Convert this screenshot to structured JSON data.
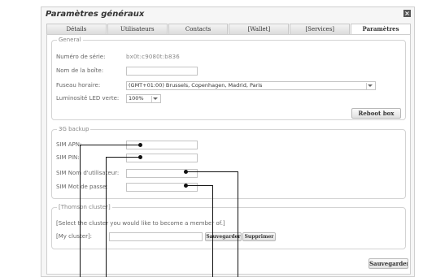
{
  "dialog": {
    "title": "Paramètres généraux",
    "close_icon": "close-icon"
  },
  "tabs": [
    {
      "label": "Détails",
      "active": false
    },
    {
      "label": "Utilisateurs",
      "active": false
    },
    {
      "label": "Contacts",
      "active": false
    },
    {
      "label": "[Wallet]",
      "active": false
    },
    {
      "label": "[Services]",
      "active": false
    },
    {
      "label": "Paramètres",
      "active": true
    }
  ],
  "general": {
    "legend": "General",
    "serial_label": "Numéro de série:",
    "serial_value": "bx0t:c9080t:b836",
    "box_name_label": "Nom de la boîte:",
    "box_name_value": "",
    "timezone_label": "Fuseau horaire:",
    "timezone_value": "(GMT+01:00) Brussels, Copenhagen, Madrid, Paris",
    "led_label": "Luminosité LED verte:",
    "led_value": "100%",
    "reboot_button": "Reboot box"
  },
  "backup3g": {
    "legend": "3G backup",
    "apn_label": "SIM APN:",
    "pin_label": "SIM PIN:",
    "user_label": "SIM Nom d'utilisateur:",
    "password_label": "SIM Mot de passe:"
  },
  "cluster": {
    "legend": "[Thomson cluster]",
    "description": "[Select the cluster you would like to become a member of.]",
    "my_cluster_label": "[My cluster]:",
    "save_button": "Sauvegarder",
    "delete_button": "Supprimer"
  },
  "footer": {
    "save_button": "Sauvegarder"
  }
}
